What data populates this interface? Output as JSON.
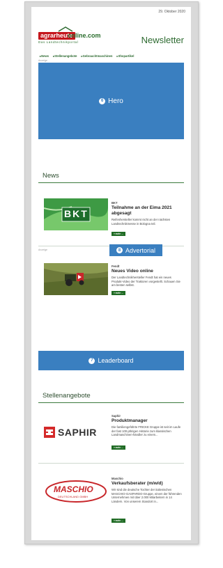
{
  "newsletter": {
    "date": "29. Oktober 2020",
    "title": "Newsletter",
    "brand": {
      "agri": "agrarheute",
      "online": "online.com",
      "tagline": "Das Landtechnikportal"
    },
    "nav": [
      "News",
      "Stellenangebote",
      "Gebrauchtmaschinen",
      "Shopartikel"
    ],
    "ad_label": "Anzeige"
  },
  "callouts": {
    "hero": {
      "number": "6",
      "label": "Hero"
    },
    "advertorial": {
      "number": "8",
      "label": "Advertorial"
    },
    "leaderboard": {
      "number": "7",
      "label": "Leaderboard"
    }
  },
  "sections": {
    "news": "News",
    "jobs": "Stellenangebote"
  },
  "news_items": [
    {
      "label": "BKT",
      "title": "Teilnahme an der Eima 2021 abgesagt",
      "text": "Reifenhersteller kommt nicht an der nächsten Landtechnikmesse in Bologna teil.",
      "more": "» mehr ...",
      "thumb_text": "BKT"
    },
    {
      "label": "Fendt",
      "title": "Neues Video online",
      "text": "Der Landtechnikhersteller Fendt hat ein neues Produkt-Video der Traktoren vorgestellt. Schauen Sie am besten selbst.",
      "more": "» mehr ..."
    }
  ],
  "jobs": [
    {
      "label": "Saphir",
      "title": "Produktmanager",
      "text": "Die familiengeführte FRICKE Gruppe ist seit im Laufe der fast 100-jährigen Historie zum klassischen Landmaschinen-händler zu einem...",
      "more": "» mehr ...",
      "logo": "SAPHIR"
    },
    {
      "label": "Maschio",
      "title": "Verkaufsberater (m/w/d)",
      "text": "Wir sind die deutsche Tochter der italienischen MASCHIO-GASPARDO-Gruppe, einem der führenden Unternehmen mit über 2.000 Mitarbeitern in 14 Ländern. Von unserem Standort in...",
      "more": "» mehr ...",
      "logo": "MASCHIO",
      "logo_sub": "DEUTSCHLAND GMBH"
    }
  ],
  "colors": {
    "accent_green": "#2d6a30",
    "callout_blue": "#3a7fc0",
    "brand_red": "#c4161c"
  }
}
